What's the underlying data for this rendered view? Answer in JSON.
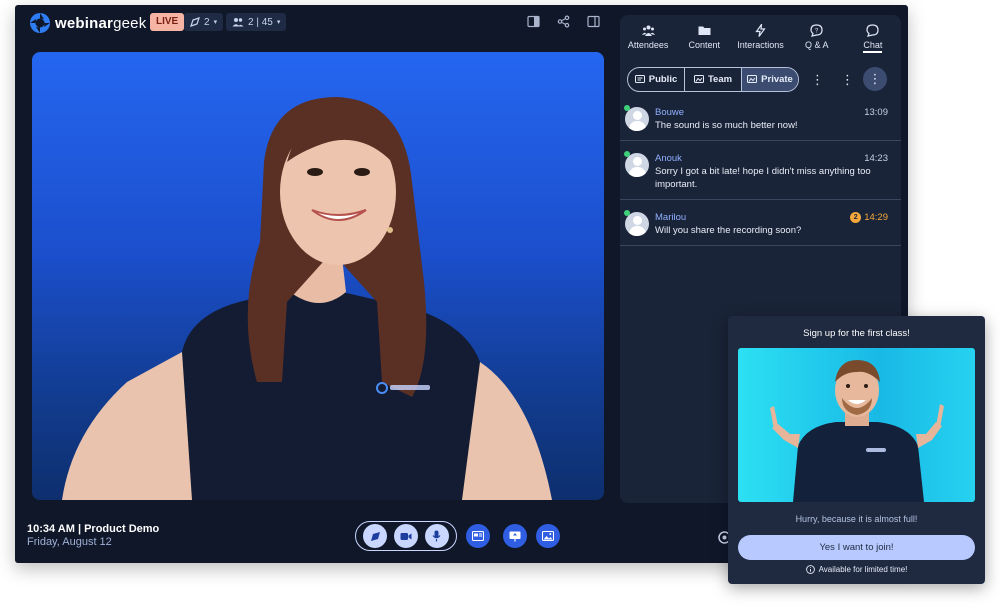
{
  "app": {
    "logo_text_bold": "webinar",
    "logo_text_light": "geek",
    "live_label": "LIVE",
    "presenters_count": "2",
    "attendees_count": "2 | 45"
  },
  "footer": {
    "time_title": "10:34 AM | Product Demo",
    "date": "Friday, August 12"
  },
  "panel": {
    "tabs": [
      {
        "label": "Attendees",
        "icon": "attendees-icon"
      },
      {
        "label": "Content",
        "icon": "folder-icon"
      },
      {
        "label": "Interactions",
        "icon": "lightning-icon"
      },
      {
        "label": "Q & A",
        "icon": "question-bubble-icon"
      },
      {
        "label": "Chat",
        "icon": "chat-bubble-icon",
        "active": true
      }
    ],
    "segments": [
      {
        "label": "Public",
        "icon": "public-chat-icon"
      },
      {
        "label": "Team",
        "icon": "team-chat-icon"
      },
      {
        "label": "Private",
        "icon": "private-chat-icon",
        "selected": true
      }
    ],
    "messages": [
      {
        "name": "Bouwe",
        "time": "13:09",
        "text": "The sound is so much better now!"
      },
      {
        "name": "Anouk",
        "time": "14:23",
        "text": "Sorry I got a bit late! hope I didn't miss anything too important."
      },
      {
        "name": "Marilou",
        "time": "14:29",
        "unread": "2",
        "text": "Will you share the recording soon?"
      }
    ]
  },
  "popup": {
    "title": "Sign up for the first class!",
    "hint": "Hurry, because it is almost full!",
    "button_label": "Yes I want to join!",
    "note": "Available for limited time!"
  },
  "colors": {
    "app_bg": "#0f1729",
    "panel_bg": "#1a2438",
    "live_badge": "#f6b4a4",
    "accent_blue": "#2f5ee3",
    "unread_orange": "#f3a73b",
    "online_green": "#3fd07a"
  }
}
